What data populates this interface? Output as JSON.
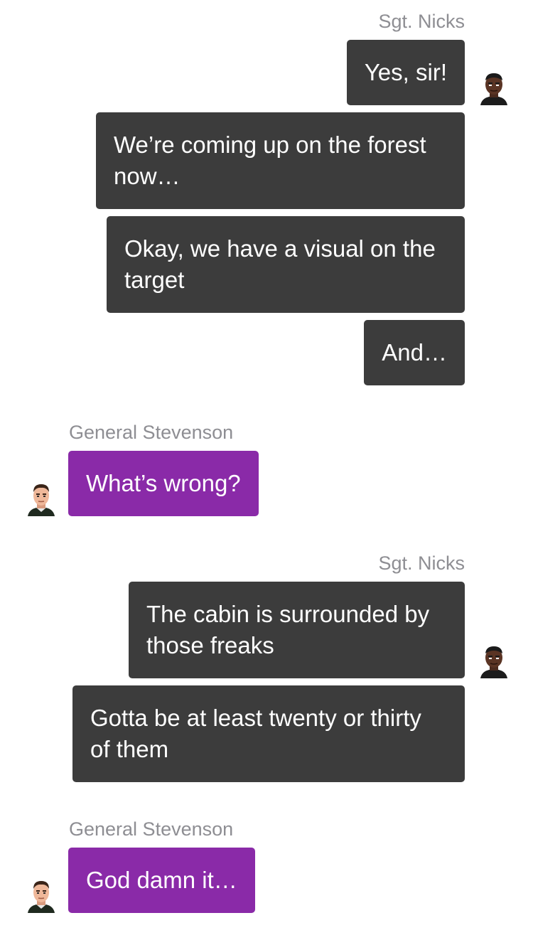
{
  "characters": {
    "npc": {
      "name": "Sgt. Nicks",
      "avatar_icon": "soldier-avatar-icon",
      "bubble_color": "#3c3c3c"
    },
    "player": {
      "name": "General Stevenson",
      "avatar_icon": "general-avatar-icon",
      "bubble_color": "#8a2aa8"
    }
  },
  "groups": [
    {
      "speaker": "Sgt. Nicks",
      "messages": [
        "Yes, sir!",
        "We’re coming up on the forest now…",
        "Okay, we have a visual on the target",
        "And…"
      ]
    },
    {
      "speaker": "General Stevenson",
      "messages": [
        "What’s wrong?"
      ]
    },
    {
      "speaker": "Sgt. Nicks",
      "messages": [
        "The cabin is surrounded by those freaks",
        "Gotta be at least twenty or thirty of them"
      ]
    },
    {
      "speaker": "General Stevenson",
      "messages": [
        "God damn it…"
      ]
    }
  ]
}
